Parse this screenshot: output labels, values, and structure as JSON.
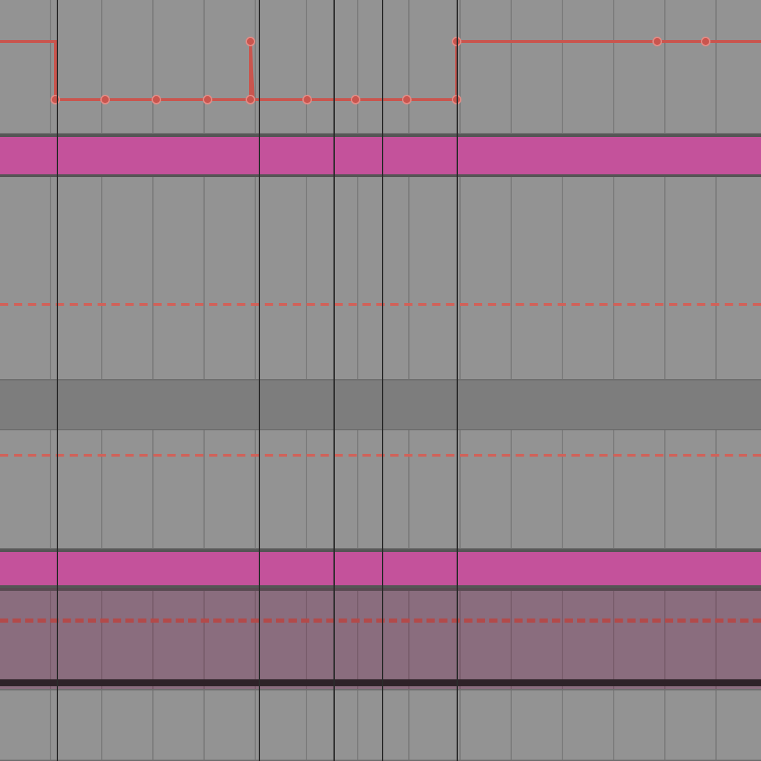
{
  "lanes": [
    {
      "kind": "automation"
    },
    {
      "kind": "clip",
      "color": "#c4529b"
    },
    {
      "kind": "empty",
      "dashed": true
    },
    {
      "kind": "band"
    },
    {
      "kind": "empty",
      "dashed": true
    },
    {
      "kind": "clip",
      "color": "#c4529b"
    },
    {
      "kind": "audio",
      "dashed": true
    },
    {
      "kind": "empty"
    }
  ]
}
